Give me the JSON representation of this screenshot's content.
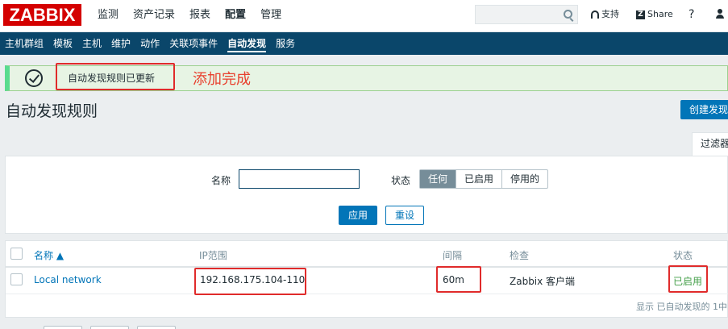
{
  "header": {
    "logo": "ZABBIX",
    "main_menu": [
      "监测",
      "资产记录",
      "报表",
      "配置",
      "管理"
    ],
    "search_placeholder": "",
    "support": "支持",
    "share": "Share",
    "help": "?"
  },
  "submenu": [
    "主机群组",
    "模板",
    "主机",
    "维护",
    "动作",
    "关联项事件",
    "自动发现",
    "服务"
  ],
  "message": {
    "text": "自动发现规则已更新",
    "annotation": "添加完成"
  },
  "page": {
    "title": "自动发现规则",
    "create_button": "创建发现",
    "filter_tab": "过滤器"
  },
  "filter": {
    "name_label": "名称",
    "name_value": "",
    "status_label": "状态",
    "status_options": [
      "任何",
      "已启用",
      "停用的"
    ],
    "status_selected": "任何",
    "apply": "应用",
    "reset": "重设"
  },
  "table": {
    "headers": [
      "名称 ▲",
      "IP范围",
      "间隔",
      "检查",
      "状态"
    ],
    "rows": [
      {
        "name": "Local network",
        "ip_range": "192.168.175.104-110",
        "interval": "60m",
        "checks": "Zabbix 客户端",
        "status": "已启用"
      }
    ],
    "footer": "显示 已自动发现的 1中"
  },
  "colors": {
    "brand": "#d40000",
    "nav": "#0a466a",
    "accent": "#0275b8",
    "success": "#429e47",
    "annotation": "#e02b2b"
  }
}
